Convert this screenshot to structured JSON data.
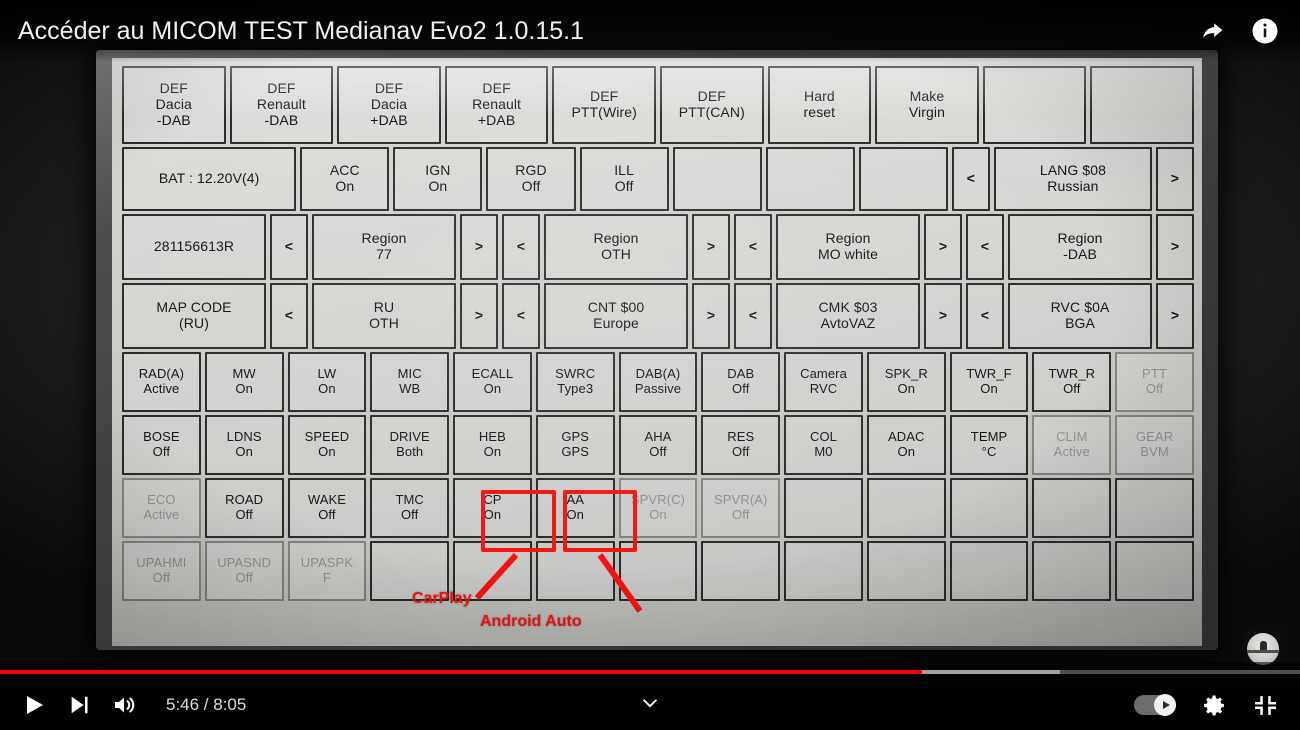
{
  "player": {
    "title": "Accéder au MICOM TEST Medianav Evo2 1.0.15.1",
    "time_current": "5:46",
    "time_total": "8:05",
    "time_display": "5:46 / 8:05",
    "play_label": "Play",
    "next_label": "Next",
    "volume_label": "Mute",
    "autoplay_label": "Autoplay",
    "settings_label": "Settings",
    "fullscreen_label": "Exit full screen",
    "expand_label": "Show more",
    "share_label": "Share",
    "info_label": "More info",
    "progress_percent": 70.9,
    "buffer_percent": 81.5,
    "accent_color": "#f00000"
  },
  "annotations": {
    "highlight_color": "#f41313",
    "carplay_label": "CarPlay",
    "android_auto_label": "Android Auto"
  },
  "grid": {
    "rows": [
      {
        "id": "row-1",
        "cells": [
          {
            "l1": "DEF",
            "l2": "Dacia",
            "l3": "-DAB"
          },
          {
            "l1": "DEF",
            "l2": "Renault",
            "l3": "-DAB"
          },
          {
            "l1": "DEF",
            "l2": "Dacia",
            "l3": "+DAB"
          },
          {
            "l1": "DEF",
            "l2": "Renault",
            "l3": "+DAB"
          },
          {
            "l1": "DEF",
            "l2": "PTT(Wire)"
          },
          {
            "l1": "DEF",
            "l2": "PTT(CAN)"
          },
          {
            "l1": "Hard",
            "l2": "reset"
          },
          {
            "l1": "Make",
            "l2": "Virgin"
          },
          {
            "l1": "",
            "blank": true
          },
          {
            "l1": "",
            "blank": true
          }
        ]
      },
      {
        "id": "row-2",
        "cells": [
          {
            "l1": "BAT :  12.20V(4)",
            "wide2": true
          },
          {
            "l1": "ACC",
            "l2": "On"
          },
          {
            "l1": "IGN",
            "l2": "On"
          },
          {
            "l1": "RGD",
            "l2": "Off"
          },
          {
            "l1": "ILL",
            "l2": "Off"
          },
          {
            "l1": "",
            "blank": true
          },
          {
            "l1": "",
            "blank": true
          },
          {
            "l1": "",
            "blank": true
          },
          {
            "l1": "<",
            "arrow": true
          },
          {
            "l1": "LANG $08",
            "l2": "Russian",
            "wide_lang": true
          },
          {
            "l1": ">",
            "arrow": true
          }
        ]
      },
      {
        "id": "row-3",
        "cells": [
          {
            "l1": "281156613R"
          },
          {
            "l1": "<",
            "arrow": true
          },
          {
            "l1": "Region",
            "l2": "77"
          },
          {
            "l1": ">",
            "arrow": true
          },
          {
            "l1": "<",
            "arrow": true
          },
          {
            "l1": "Region",
            "l2": "OTH"
          },
          {
            "l1": ">",
            "arrow": true
          },
          {
            "l1": "<",
            "arrow": true
          },
          {
            "l1": "Region",
            "l2": "MO white"
          },
          {
            "l1": ">",
            "arrow": true
          },
          {
            "l1": "<",
            "arrow": true
          },
          {
            "l1": "Region",
            "l2": "-DAB"
          },
          {
            "l1": ">",
            "arrow": true
          }
        ]
      },
      {
        "id": "row-4",
        "cells": [
          {
            "l1": "MAP CODE",
            "l2": "(RU)"
          },
          {
            "l1": "<",
            "arrow": true
          },
          {
            "l1": "RU",
            "l2": "OTH"
          },
          {
            "l1": ">",
            "arrow": true
          },
          {
            "l1": "<",
            "arrow": true
          },
          {
            "l1": "CNT $00",
            "l2": "Europe"
          },
          {
            "l1": ">",
            "arrow": true
          },
          {
            "l1": "<",
            "arrow": true
          },
          {
            "l1": "CMK $03",
            "l2": "AvtoVAZ"
          },
          {
            "l1": ">",
            "arrow": true
          },
          {
            "l1": "<",
            "arrow": true
          },
          {
            "l1": "RVC $0A",
            "l2": "BGA"
          },
          {
            "l1": ">",
            "arrow": true
          }
        ]
      },
      {
        "id": "row-5",
        "cells": [
          {
            "l1": "RAD(A)",
            "l2": "Active"
          },
          {
            "l1": "MW",
            "l2": "On"
          },
          {
            "l1": "LW",
            "l2": "On"
          },
          {
            "l1": "MIC",
            "l2": "WB"
          },
          {
            "l1": "ECALL",
            "l2": "On"
          },
          {
            "l1": "SWRC",
            "l2": "Type3"
          },
          {
            "l1": "DAB(A)",
            "l2": "Passive"
          },
          {
            "l1": "DAB",
            "l2": "Off"
          },
          {
            "l1": "Camera",
            "l2": "RVC"
          },
          {
            "l1": "SPK_R",
            "l2": "On"
          },
          {
            "l1": "TWR_F",
            "l2": "On"
          },
          {
            "l1": "TWR_R",
            "l2": "Off"
          },
          {
            "l1": "PTT",
            "l2": "Off",
            "faded": true
          }
        ]
      },
      {
        "id": "row-6",
        "cells": [
          {
            "l1": "BOSE",
            "l2": "Off"
          },
          {
            "l1": "LDNS",
            "l2": "On"
          },
          {
            "l1": "SPEED",
            "l2": "On"
          },
          {
            "l1": "DRIVE",
            "l2": "Both"
          },
          {
            "l1": "HEB",
            "l2": "On"
          },
          {
            "l1": "GPS",
            "l2": "GPS"
          },
          {
            "l1": "AHA",
            "l2": "Off"
          },
          {
            "l1": "RES",
            "l2": "Off"
          },
          {
            "l1": "COL",
            "l2": "M0"
          },
          {
            "l1": "ADAC",
            "l2": "On"
          },
          {
            "l1": "TEMP",
            "l2": "°C"
          },
          {
            "l1": "CLIM",
            "l2": "Active",
            "faded": true
          },
          {
            "l1": "GEAR",
            "l2": "BVM",
            "faded": true
          }
        ]
      },
      {
        "id": "row-7",
        "cells": [
          {
            "l1": "ECO",
            "l2": "Active",
            "faded": true
          },
          {
            "l1": "ROAD",
            "l2": "Off"
          },
          {
            "l1": "WAKE",
            "l2": "Off"
          },
          {
            "l1": "TMC",
            "l2": "Off"
          },
          {
            "l1": "CP",
            "l2": "On"
          },
          {
            "l1": "AA",
            "l2": "On"
          },
          {
            "l1": "SPVR(C)",
            "l2": "On",
            "faded": true
          },
          {
            "l1": "SPVR(A)",
            "l2": "Off",
            "faded": true
          },
          {
            "l1": "",
            "blank": true
          },
          {
            "l1": "",
            "blank": true
          },
          {
            "l1": "",
            "blank": true
          },
          {
            "l1": "",
            "blank": true
          },
          {
            "l1": "",
            "blank": true
          }
        ]
      },
      {
        "id": "row-8",
        "cells": [
          {
            "l1": "UPAHMI",
            "l2": "Off",
            "faded": true
          },
          {
            "l1": "UPASND",
            "l2": "Off",
            "faded": true
          },
          {
            "l1": "UPASPK",
            "l2": "F",
            "faded": true
          },
          {
            "l1": "",
            "blank": true
          },
          {
            "l1": "",
            "blank": true
          },
          {
            "l1": "",
            "blank": true
          },
          {
            "l1": "",
            "blank": true
          },
          {
            "l1": "",
            "blank": true
          },
          {
            "l1": "",
            "blank": true
          },
          {
            "l1": "",
            "blank": true
          },
          {
            "l1": "",
            "blank": true
          },
          {
            "l1": "",
            "blank": true
          },
          {
            "l1": "",
            "blank": true
          }
        ]
      }
    ]
  }
}
